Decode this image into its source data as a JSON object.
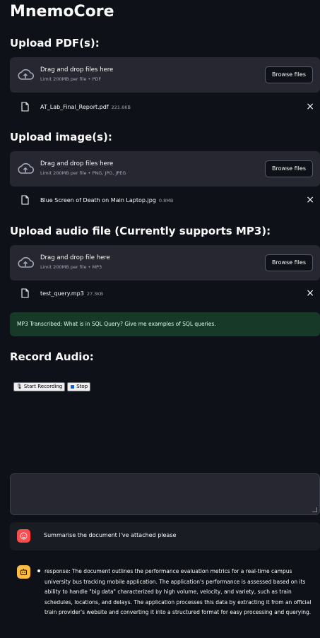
{
  "app": {
    "title": "MnemoCore"
  },
  "pdf": {
    "heading": "Upload PDF(s):",
    "drop_text": "Drag and drop files here",
    "limit": "Limit 200MB per file • PDF",
    "browse": "Browse files",
    "file": {
      "name": "AT_Lab_Final_Report.pdf",
      "size": "221.6KB"
    }
  },
  "image": {
    "heading": "Upload image(s):",
    "drop_text": "Drag and drop files here",
    "limit": "Limit 200MB per file • PNG, JPG, JPEG",
    "browse": "Browse files",
    "file": {
      "name": "Blue Screen of Death on Main Laptop.jpg",
      "size": "0.8MB"
    }
  },
  "audio": {
    "heading": "Upload audio file (Currently supports MP3):",
    "drop_text": "Drag and drop file here",
    "limit": "Limit 200MB per file • MP3",
    "browse": "Browse files",
    "file": {
      "name": "test_query.mp3",
      "size": "27.3KB"
    }
  },
  "transcription": "MP3 Transcribed: What is in SQL Query? Give me examples of SQL queries.",
  "record": {
    "heading": "Record Audio:",
    "start_label": "Start Recording",
    "stop_label": "Stop"
  },
  "chat": {
    "user_message": "Summarise the document I've attached please",
    "bot_message": "response: The document outlines the performance evaluation metrics for a real-time campus university bus tracking mobile application. The application's performance is assessed based on its ability to handle \"big data\" characterized by high volume, velocity, and variety, such as train schedules, locations, and delays. The application processes this data by extracting it from an official train provider's website and converting it into a structured format for easy processing and querying."
  },
  "icons": {
    "upload": "cloud-upload-icon",
    "file": "file-icon",
    "close": "close-icon",
    "user_avatar": "user-face-icon",
    "bot_avatar": "robot-icon"
  },
  "colors": {
    "background": "#0e1117",
    "panel": "#262730",
    "success_bg": "#173928",
    "user_avatar": "#ff4b4b",
    "bot_avatar": "#ffbd45"
  }
}
